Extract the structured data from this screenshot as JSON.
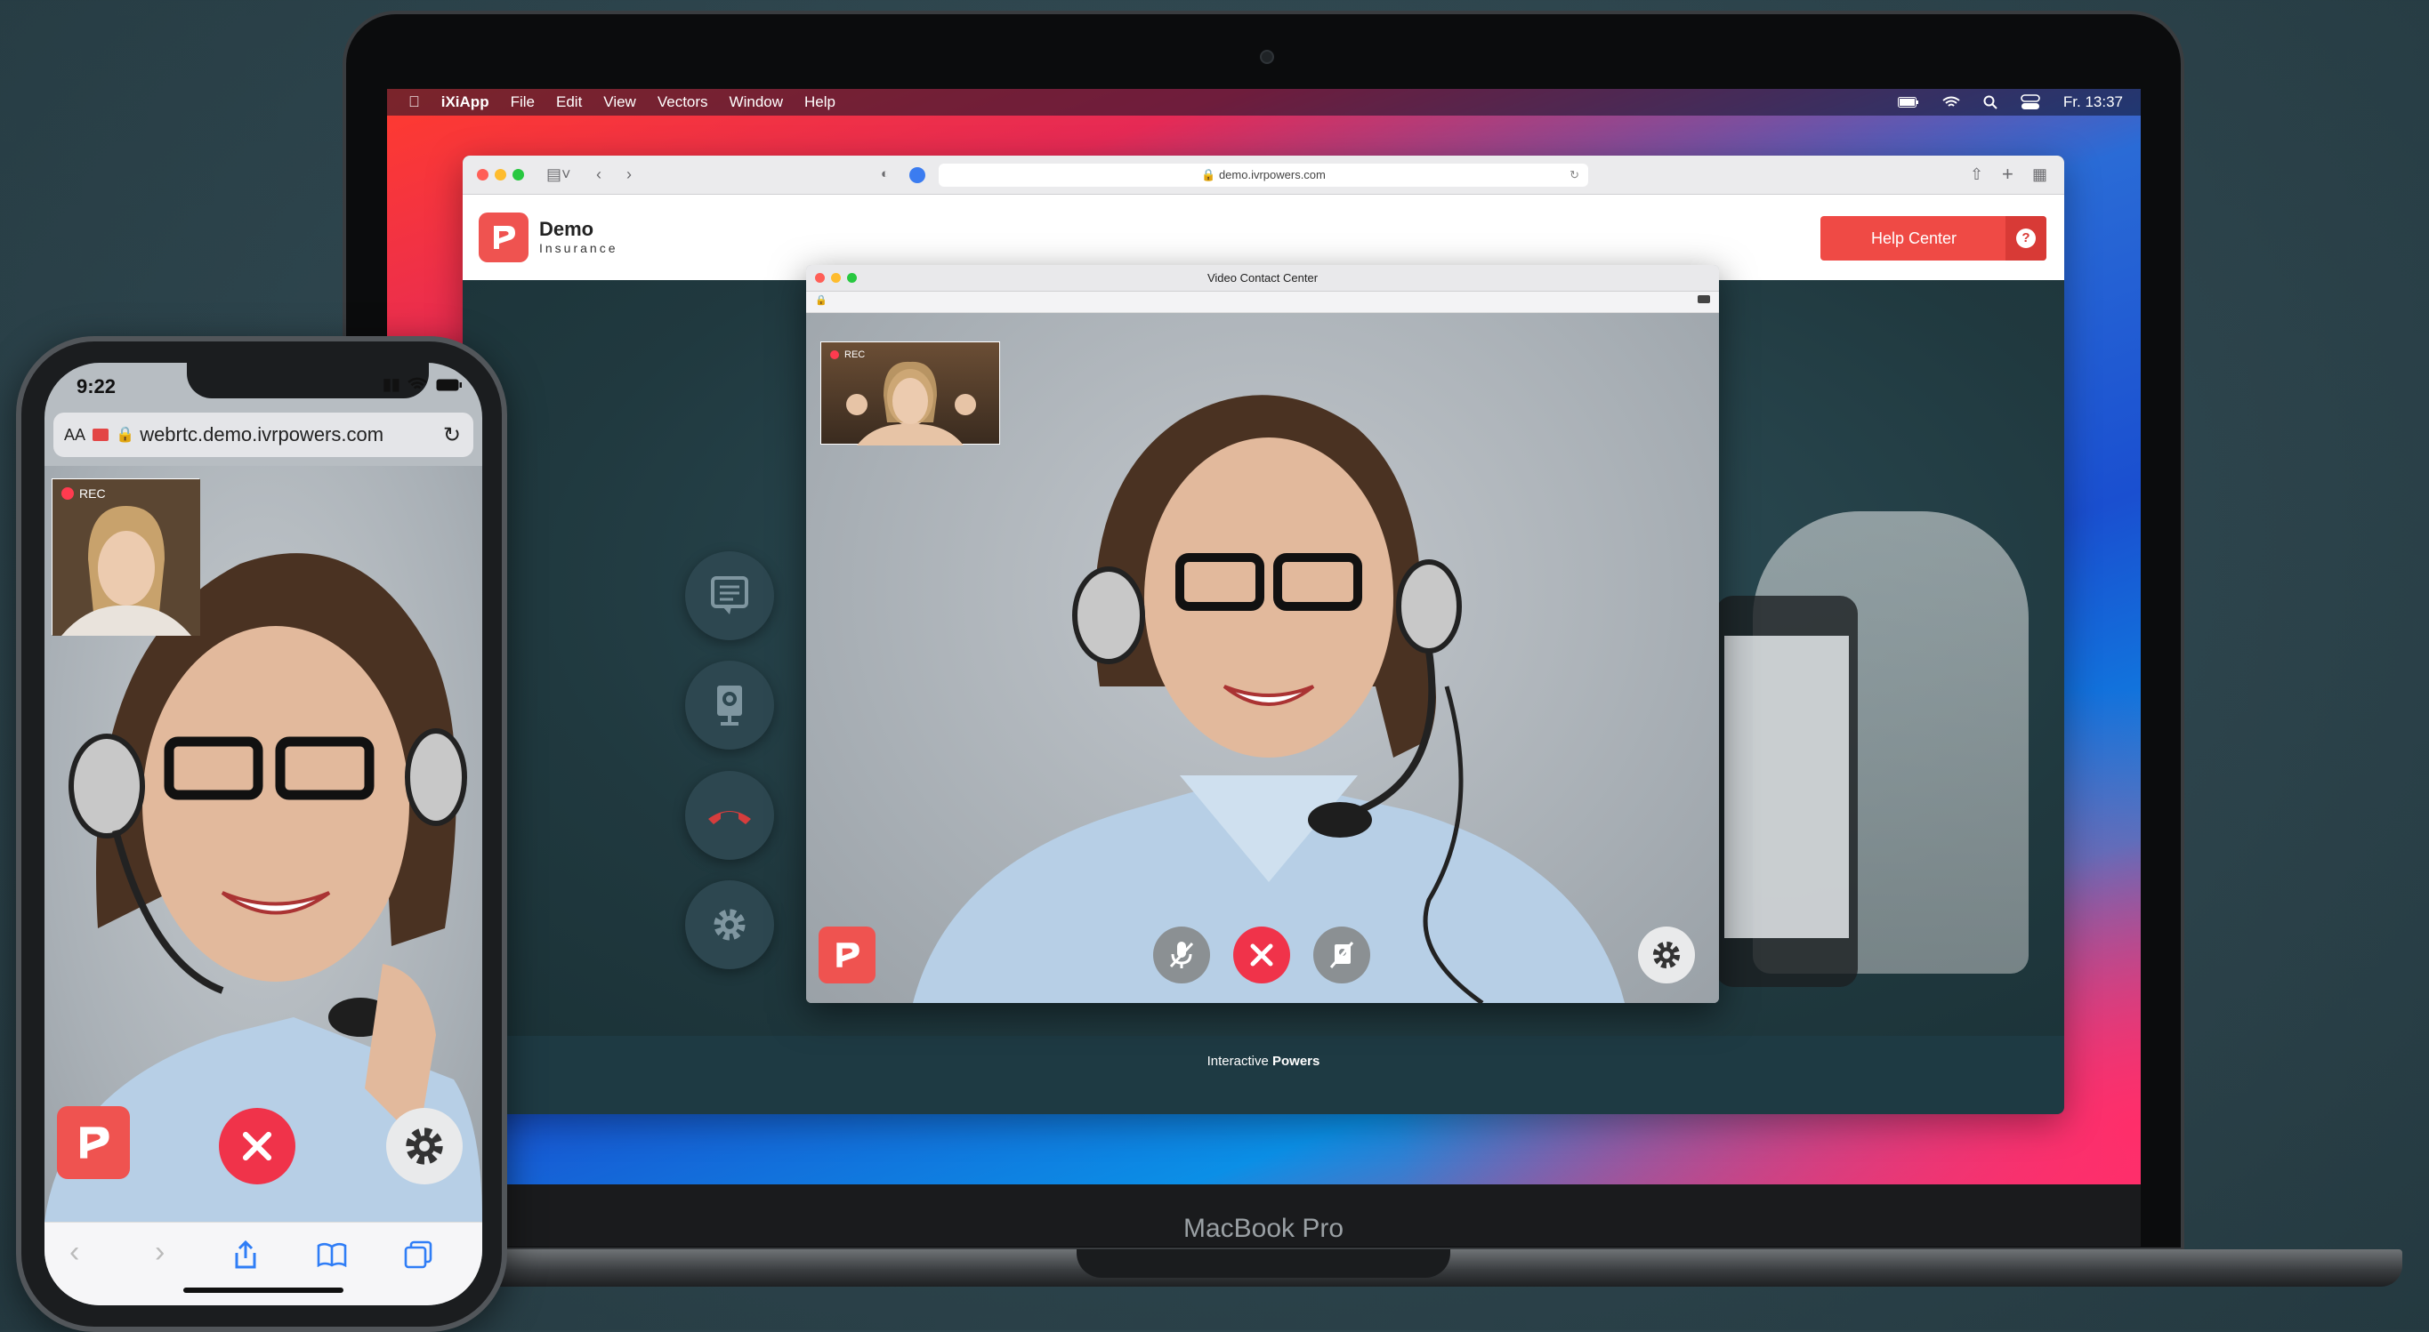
{
  "mac": {
    "label": "MacBook Pro",
    "menubar": {
      "app": "iXiApp",
      "menus": [
        "File",
        "Edit",
        "View",
        "Vectors",
        "Window",
        "Help"
      ],
      "clock": "Fr. 13:37"
    }
  },
  "safari": {
    "url": "demo.ivrpowers.com"
  },
  "site": {
    "logo_title": "Demo",
    "logo_subtitle": "Insurance",
    "help_button": "Help Center",
    "help_icon": "?",
    "footer_prefix": "Interactive ",
    "footer_brand": "Powers"
  },
  "vcc": {
    "title": "Video Contact Center",
    "rec_label": "REC",
    "controls": [
      "mic-muted-icon",
      "hangup-icon",
      "video-off-icon",
      "settings-icon"
    ]
  },
  "side_buttons": [
    "chat-icon",
    "webcam-icon",
    "phone-hangup-icon",
    "gear-icon"
  ],
  "iphone": {
    "time": "9:22",
    "aa": "AA",
    "url": "webrtc.demo.ivrpowers.com",
    "rec_label": "REC"
  },
  "colors": {
    "brand": "#ef4a45",
    "hangup": "#f0334a",
    "page_bg": "#20393f"
  }
}
